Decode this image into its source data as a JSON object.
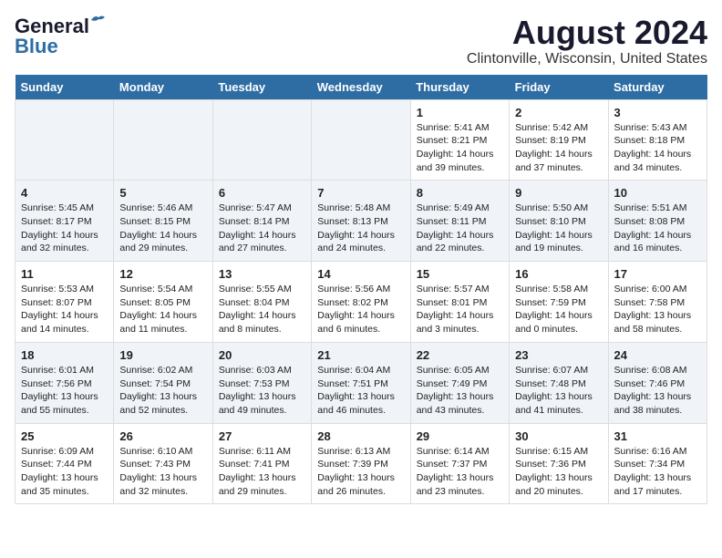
{
  "logo": {
    "line1": "General",
    "line2": "Blue"
  },
  "title": "August 2024",
  "subtitle": "Clintonville, Wisconsin, United States",
  "days_of_week": [
    "Sunday",
    "Monday",
    "Tuesday",
    "Wednesday",
    "Thursday",
    "Friday",
    "Saturday"
  ],
  "weeks": [
    [
      {
        "day": "",
        "info": ""
      },
      {
        "day": "",
        "info": ""
      },
      {
        "day": "",
        "info": ""
      },
      {
        "day": "",
        "info": ""
      },
      {
        "day": "1",
        "info": "Sunrise: 5:41 AM\nSunset: 8:21 PM\nDaylight: 14 hours\nand 39 minutes."
      },
      {
        "day": "2",
        "info": "Sunrise: 5:42 AM\nSunset: 8:19 PM\nDaylight: 14 hours\nand 37 minutes."
      },
      {
        "day": "3",
        "info": "Sunrise: 5:43 AM\nSunset: 8:18 PM\nDaylight: 14 hours\nand 34 minutes."
      }
    ],
    [
      {
        "day": "4",
        "info": "Sunrise: 5:45 AM\nSunset: 8:17 PM\nDaylight: 14 hours\nand 32 minutes."
      },
      {
        "day": "5",
        "info": "Sunrise: 5:46 AM\nSunset: 8:15 PM\nDaylight: 14 hours\nand 29 minutes."
      },
      {
        "day": "6",
        "info": "Sunrise: 5:47 AM\nSunset: 8:14 PM\nDaylight: 14 hours\nand 27 minutes."
      },
      {
        "day": "7",
        "info": "Sunrise: 5:48 AM\nSunset: 8:13 PM\nDaylight: 14 hours\nand 24 minutes."
      },
      {
        "day": "8",
        "info": "Sunrise: 5:49 AM\nSunset: 8:11 PM\nDaylight: 14 hours\nand 22 minutes."
      },
      {
        "day": "9",
        "info": "Sunrise: 5:50 AM\nSunset: 8:10 PM\nDaylight: 14 hours\nand 19 minutes."
      },
      {
        "day": "10",
        "info": "Sunrise: 5:51 AM\nSunset: 8:08 PM\nDaylight: 14 hours\nand 16 minutes."
      }
    ],
    [
      {
        "day": "11",
        "info": "Sunrise: 5:53 AM\nSunset: 8:07 PM\nDaylight: 14 hours\nand 14 minutes."
      },
      {
        "day": "12",
        "info": "Sunrise: 5:54 AM\nSunset: 8:05 PM\nDaylight: 14 hours\nand 11 minutes."
      },
      {
        "day": "13",
        "info": "Sunrise: 5:55 AM\nSunset: 8:04 PM\nDaylight: 14 hours\nand 8 minutes."
      },
      {
        "day": "14",
        "info": "Sunrise: 5:56 AM\nSunset: 8:02 PM\nDaylight: 14 hours\nand 6 minutes."
      },
      {
        "day": "15",
        "info": "Sunrise: 5:57 AM\nSunset: 8:01 PM\nDaylight: 14 hours\nand 3 minutes."
      },
      {
        "day": "16",
        "info": "Sunrise: 5:58 AM\nSunset: 7:59 PM\nDaylight: 14 hours\nand 0 minutes."
      },
      {
        "day": "17",
        "info": "Sunrise: 6:00 AM\nSunset: 7:58 PM\nDaylight: 13 hours\nand 58 minutes."
      }
    ],
    [
      {
        "day": "18",
        "info": "Sunrise: 6:01 AM\nSunset: 7:56 PM\nDaylight: 13 hours\nand 55 minutes."
      },
      {
        "day": "19",
        "info": "Sunrise: 6:02 AM\nSunset: 7:54 PM\nDaylight: 13 hours\nand 52 minutes."
      },
      {
        "day": "20",
        "info": "Sunrise: 6:03 AM\nSunset: 7:53 PM\nDaylight: 13 hours\nand 49 minutes."
      },
      {
        "day": "21",
        "info": "Sunrise: 6:04 AM\nSunset: 7:51 PM\nDaylight: 13 hours\nand 46 minutes."
      },
      {
        "day": "22",
        "info": "Sunrise: 6:05 AM\nSunset: 7:49 PM\nDaylight: 13 hours\nand 43 minutes."
      },
      {
        "day": "23",
        "info": "Sunrise: 6:07 AM\nSunset: 7:48 PM\nDaylight: 13 hours\nand 41 minutes."
      },
      {
        "day": "24",
        "info": "Sunrise: 6:08 AM\nSunset: 7:46 PM\nDaylight: 13 hours\nand 38 minutes."
      }
    ],
    [
      {
        "day": "25",
        "info": "Sunrise: 6:09 AM\nSunset: 7:44 PM\nDaylight: 13 hours\nand 35 minutes."
      },
      {
        "day": "26",
        "info": "Sunrise: 6:10 AM\nSunset: 7:43 PM\nDaylight: 13 hours\nand 32 minutes."
      },
      {
        "day": "27",
        "info": "Sunrise: 6:11 AM\nSunset: 7:41 PM\nDaylight: 13 hours\nand 29 minutes."
      },
      {
        "day": "28",
        "info": "Sunrise: 6:13 AM\nSunset: 7:39 PM\nDaylight: 13 hours\nand 26 minutes."
      },
      {
        "day": "29",
        "info": "Sunrise: 6:14 AM\nSunset: 7:37 PM\nDaylight: 13 hours\nand 23 minutes."
      },
      {
        "day": "30",
        "info": "Sunrise: 6:15 AM\nSunset: 7:36 PM\nDaylight: 13 hours\nand 20 minutes."
      },
      {
        "day": "31",
        "info": "Sunrise: 6:16 AM\nSunset: 7:34 PM\nDaylight: 13 hours\nand 17 minutes."
      }
    ]
  ]
}
